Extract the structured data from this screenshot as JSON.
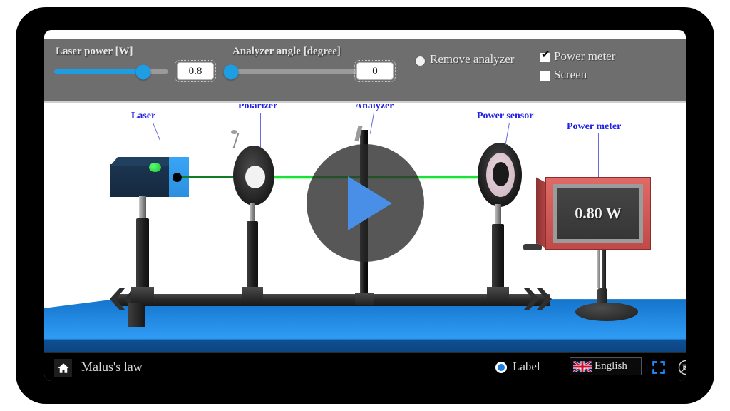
{
  "app": {
    "title": "Malus's law"
  },
  "toolbar": {
    "laser_power": {
      "label": "Laser power [W]",
      "value": "0.8",
      "slider_percent": 78,
      "min": 0,
      "max": 1
    },
    "analyzer_angle": {
      "label": "Analyzer angle [degree]",
      "value": "0",
      "slider_percent": 0,
      "min": 0,
      "max": 360
    },
    "remove_analyzer": {
      "label": "Remove analyzer",
      "checked": false,
      "icon": "radio-dot-icon"
    },
    "power_meter": {
      "label": "Power meter",
      "checked": true,
      "check_glyph": "✔",
      "icon": "checkbox-icon"
    },
    "screen": {
      "label": "Screen",
      "checked": false,
      "icon": "checkbox-icon"
    },
    "bar_color": "#6e6e6e",
    "accent_color": "#1e9de3"
  },
  "scene": {
    "callouts": [
      {
        "id": "laser",
        "label": "Laser"
      },
      {
        "id": "polarizer",
        "label": "Polarizer"
      },
      {
        "id": "analyzer",
        "label": "Analyzer"
      },
      {
        "id": "power-sensor",
        "label": "Power sensor"
      },
      {
        "id": "power-meter",
        "label": "Power meter"
      }
    ],
    "callout_color": "#2323e8",
    "beam_color": "#19e235",
    "power_meter_display": "0.80 W",
    "play_overlay": {
      "icon": "play-triangle-icon",
      "color": "#4a8fe7"
    },
    "table_color": "#2a93ec"
  },
  "bottombar": {
    "home_icon": "home-icon",
    "title": "Malus's law",
    "label_toggle": {
      "label": "Label",
      "selected": true,
      "icon": "radio-selected-icon"
    },
    "language": {
      "label": "English",
      "flag": "uk-flag-icon"
    },
    "fullscreen_icon": "fullscreen-icon",
    "nologo_icon": "no-watermark-icon"
  }
}
